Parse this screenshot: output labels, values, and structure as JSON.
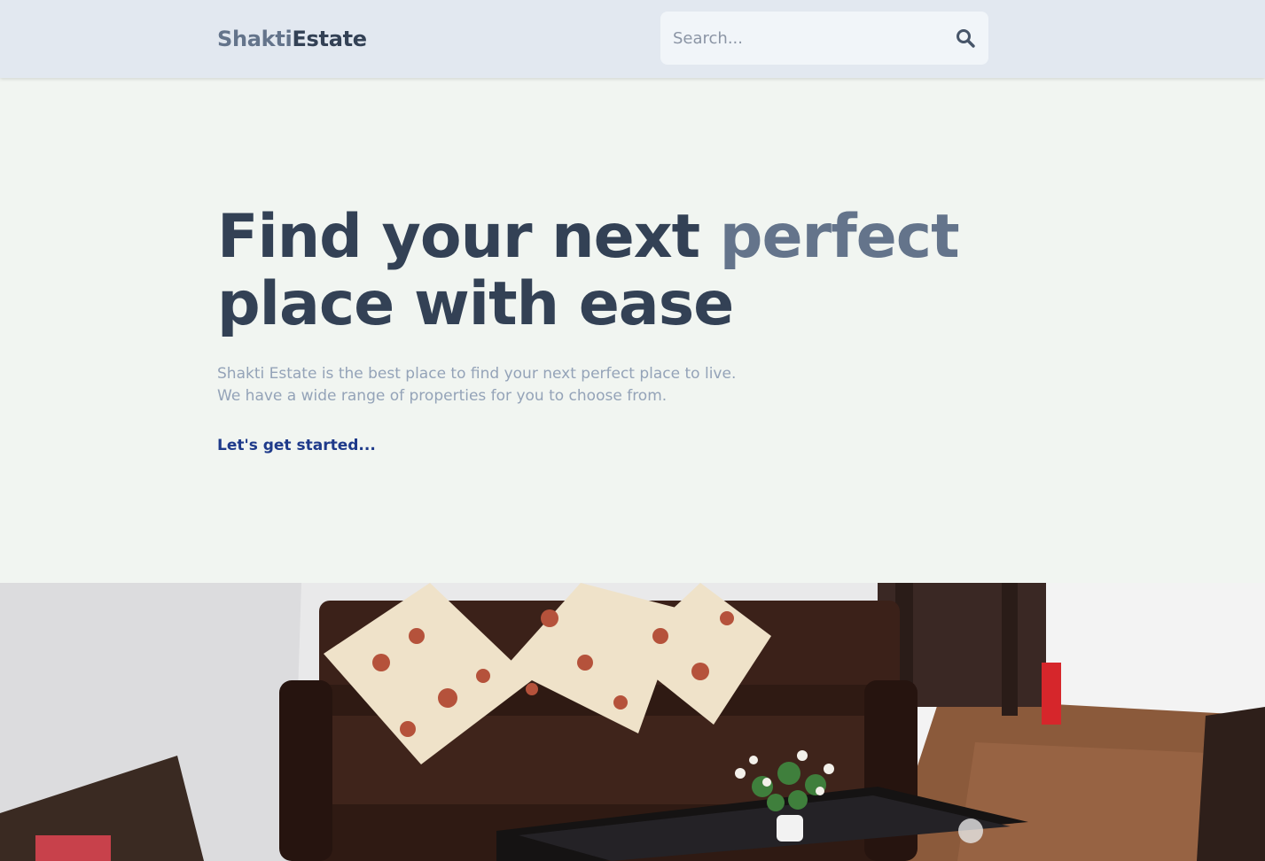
{
  "header": {
    "logo_part1": "Shakti",
    "logo_part2": "Estate",
    "search": {
      "placeholder": "Search...",
      "icon": "search-icon"
    }
  },
  "hero": {
    "title_line1_main": "Find your next ",
    "title_line1_accent": "perfect",
    "title_line2": "place with ease",
    "description_line1": "Shakti Estate is the best place to find your next perfect place to live.",
    "description_line2": "We have a wide range of properties for you to choose from.",
    "cta_label": "Let's get started..."
  },
  "colors": {
    "header_bg": "#e2e8f0",
    "page_bg": "#f1f5f1",
    "heading": "#334155",
    "accent": "#64748b",
    "muted_text": "#94a3b8",
    "link": "#1e3a8a"
  }
}
